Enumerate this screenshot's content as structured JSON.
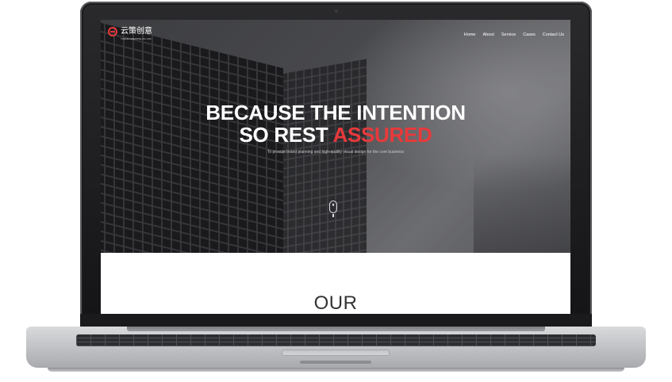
{
  "site": {
    "logo_text": "云策创意",
    "logo_sub": "YUNCE CREATIVE CO.,LTD"
  },
  "nav": {
    "items": [
      {
        "label": "Home"
      },
      {
        "label": "About"
      },
      {
        "label": "Service"
      },
      {
        "label": "Cases"
      },
      {
        "label": "Contact Us"
      }
    ]
  },
  "hero": {
    "line1": "BECAUSE THE INTENTION",
    "line2_prefix": "SO REST",
    "line2_accent": "ASSURED",
    "subline": "To provide brand planning and high-quality visual design for the core business"
  },
  "section": {
    "title": "OUR"
  },
  "colors": {
    "accent": "#e8393b",
    "hero_text": "#ffffff",
    "section_title": "#333333"
  },
  "icons": {
    "logo": "logo-mark-icon",
    "scroll": "mouse-scroll-icon"
  }
}
